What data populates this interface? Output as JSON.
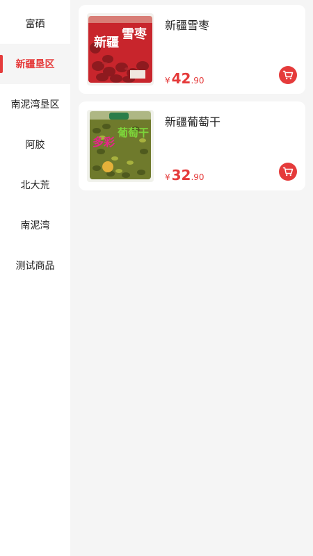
{
  "colors": {
    "accent": "#e53b3b",
    "background": "#f5f5f5",
    "card": "#ffffff"
  },
  "sidebar": {
    "items": [
      {
        "label": "富硒"
      },
      {
        "label": "新疆垦区",
        "active": true
      },
      {
        "label": "南泥湾垦区"
      },
      {
        "label": "阿胶"
      },
      {
        "label": "北大荒"
      },
      {
        "label": "南泥湾"
      },
      {
        "label": "测试商品"
      }
    ]
  },
  "products": [
    {
      "name": "新疆雪枣",
      "price_currency": "¥",
      "price_int": "42",
      "price_dec": ".90",
      "image_icon": "red-date-package-image",
      "image_text": [
        "新疆",
        "雪枣"
      ]
    },
    {
      "name": "新疆葡萄干",
      "price_currency": "¥",
      "price_int": "32",
      "price_dec": ".90",
      "image_icon": "raisin-package-image",
      "image_text": [
        "多彩",
        "葡萄干"
      ]
    }
  ],
  "icons": {
    "cart": "cart-icon"
  }
}
